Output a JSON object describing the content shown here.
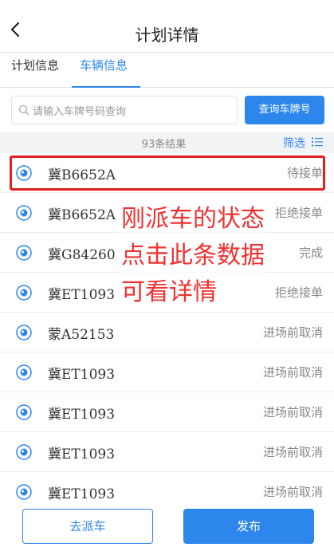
{
  "header": {
    "back_icon": "chevron-left-icon",
    "title": "计划详情"
  },
  "tabs": [
    {
      "label": "计划信息",
      "active": false
    },
    {
      "label": "车辆信息",
      "active": true
    }
  ],
  "search": {
    "placeholder": "请输入车牌号码查询",
    "button_label": "查询车牌号"
  },
  "results": {
    "count_text": "93条结果",
    "filter_label": "筛选",
    "filter_icon": "list-icon"
  },
  "rows": [
    {
      "plate": "冀B6652A",
      "status": "待接单"
    },
    {
      "plate": "冀B6652A",
      "status": "拒绝接单"
    },
    {
      "plate": "冀G84260",
      "status": "完成"
    },
    {
      "plate": "冀ET1093",
      "status": "拒绝接单"
    },
    {
      "plate": "蒙A52153",
      "status": "进场前取消"
    },
    {
      "plate": "冀ET1093",
      "status": "进场前取消"
    },
    {
      "plate": "冀ET1093",
      "status": "进场前取消"
    },
    {
      "plate": "冀ET1093",
      "status": "进场前取消"
    },
    {
      "plate": "冀ET1093",
      "status": "进场前取消"
    }
  ],
  "annotation": {
    "line1": "刚派车的状态",
    "line2": "点击此条数据",
    "line3": "可看详情"
  },
  "footer": {
    "dispatch_label": "去派车",
    "publish_label": "发布"
  },
  "colors": {
    "accent": "#2d86ec",
    "annotation_red": "#f23030"
  }
}
